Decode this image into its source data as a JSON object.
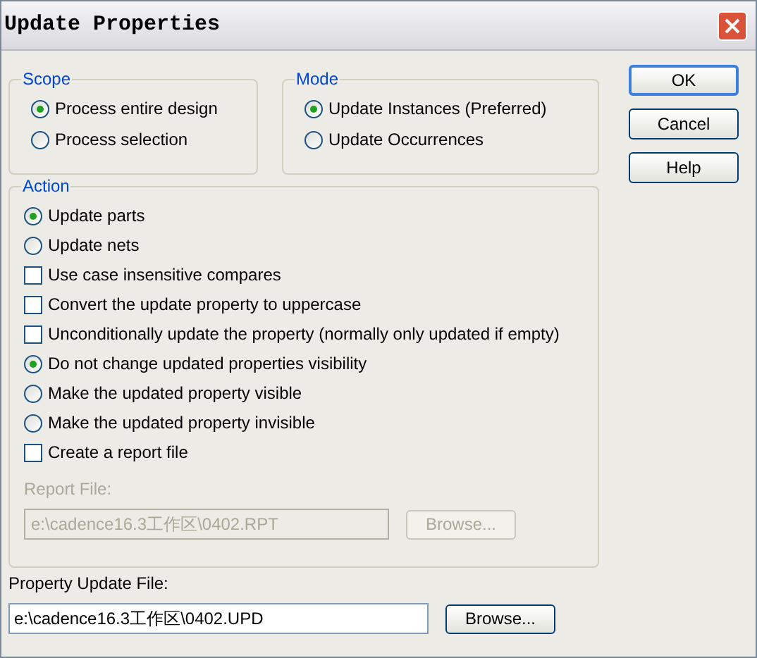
{
  "window": {
    "title": "Update Properties"
  },
  "scope": {
    "title": "Scope",
    "options": [
      {
        "label": "Process entire design",
        "selected": true
      },
      {
        "label": "Process selection",
        "selected": false
      }
    ]
  },
  "mode": {
    "title": "Mode",
    "options": [
      {
        "label": "Update Instances (Preferred)",
        "selected": true
      },
      {
        "label": "Update Occurrences",
        "selected": false
      }
    ]
  },
  "buttons": [
    {
      "label": "OK",
      "default": true
    },
    {
      "label": "Cancel",
      "default": false
    },
    {
      "label": "Help",
      "default": false
    }
  ],
  "action": {
    "title": "Action",
    "items": [
      {
        "kind": "radio",
        "label": "Update parts",
        "selected": true
      },
      {
        "kind": "radio",
        "label": "Update nets",
        "selected": false
      },
      {
        "kind": "checkbox",
        "label": "Use case insensitive compares",
        "checked": false
      },
      {
        "kind": "checkbox",
        "label": "Convert the update property to uppercase",
        "checked": false
      },
      {
        "kind": "checkbox",
        "label": "Unconditionally update the property (normally only updated if empty)",
        "checked": false
      },
      {
        "kind": "radio",
        "label": "Do not change updated properties visibility",
        "selected": true
      },
      {
        "kind": "radio",
        "label": "Make the updated property visible",
        "selected": false
      },
      {
        "kind": "radio",
        "label": "Make the updated property invisible",
        "selected": false
      },
      {
        "kind": "checkbox",
        "label": "Create a report file",
        "checked": false
      }
    ],
    "report_file": {
      "label": "Report File:",
      "value": "e:\\cadence16.3工作区\\0402.RPT",
      "disabled": true,
      "browse": "Browse..."
    }
  },
  "update_file": {
    "label": "Property Update File:",
    "value": "e:\\cadence16.3工作区\\0402.UPD",
    "browse": "Browse..."
  }
}
